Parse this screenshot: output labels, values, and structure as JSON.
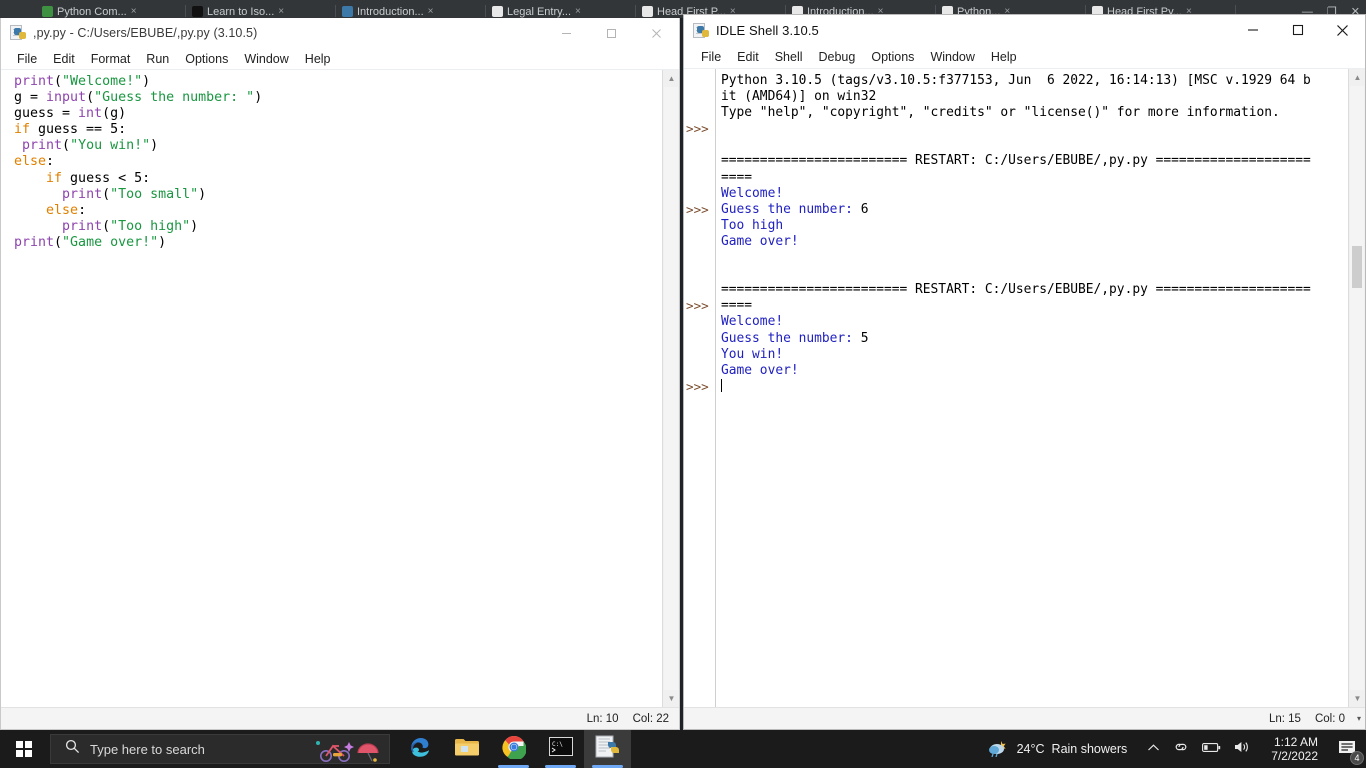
{
  "background_browser": {
    "tabs": [
      {
        "label": "Python Com...",
        "favicon_color": "#3f9142",
        "close_label": "×"
      },
      {
        "label": "Learn to Iso...",
        "favicon_color": "#111111",
        "close_label": "×"
      },
      {
        "label": "Introduction...",
        "favicon_color": "#3c78a8",
        "close_label": "×"
      },
      {
        "label": "Legal Entry...",
        "favicon_color": "#e8e8e8",
        "close_label": "×"
      },
      {
        "label": "Head First P...",
        "favicon_color": "#e8e8e8",
        "close_label": "×"
      },
      {
        "label": "Introduction...",
        "favicon_color": "#e8e8e8",
        "close_label": "×"
      },
      {
        "label": "Python...",
        "favicon_color": "#e8e8e8",
        "close_label": "×"
      },
      {
        "label": "Head First Py...",
        "favicon_color": "#e8e8e8",
        "close_label": "×"
      }
    ],
    "window_controls": {
      "minimize": "—",
      "maximize": "❐",
      "close": "✕"
    }
  },
  "editor_window": {
    "title": ",py.py - C:/Users/EBUBE/,py.py (3.10.5)",
    "icon": "python-file-icon",
    "menus": [
      "File",
      "Edit",
      "Format",
      "Run",
      "Options",
      "Window",
      "Help"
    ],
    "window_controls": {
      "minimize": "—",
      "maximize": "☐",
      "close": "✕"
    },
    "status": {
      "line_label": "Ln: 10",
      "col_label": "Col: 22"
    },
    "code_lines": [
      [
        {
          "t": "print",
          "c": "builtin"
        },
        {
          "t": "(",
          "c": "def"
        },
        {
          "t": "\"Welcome!\"",
          "c": "str"
        },
        {
          "t": ")",
          "c": "def"
        }
      ],
      [
        {
          "t": "g = ",
          "c": "def"
        },
        {
          "t": "input",
          "c": "builtin"
        },
        {
          "t": "(",
          "c": "def"
        },
        {
          "t": "\"Guess the number: \"",
          "c": "str"
        },
        {
          "t": ")",
          "c": "def"
        }
      ],
      [
        {
          "t": "guess = ",
          "c": "def"
        },
        {
          "t": "int",
          "c": "builtin"
        },
        {
          "t": "(g)",
          "c": "def"
        }
      ],
      [
        {
          "t": "if",
          "c": "kw"
        },
        {
          "t": " guess == 5:",
          "c": "def"
        }
      ],
      [
        {
          "t": " ",
          "c": "def"
        },
        {
          "t": "print",
          "c": "builtin"
        },
        {
          "t": "(",
          "c": "def"
        },
        {
          "t": "\"You win!\"",
          "c": "str"
        },
        {
          "t": ")",
          "c": "def"
        }
      ],
      [
        {
          "t": "else",
          "c": "kw"
        },
        {
          "t": ":",
          "c": "def"
        }
      ],
      [
        {
          "t": "    ",
          "c": "def"
        },
        {
          "t": "if",
          "c": "kw"
        },
        {
          "t": " guess < 5:",
          "c": "def"
        }
      ],
      [
        {
          "t": "      ",
          "c": "def"
        },
        {
          "t": "print",
          "c": "builtin"
        },
        {
          "t": "(",
          "c": "def"
        },
        {
          "t": "\"Too small\"",
          "c": "str"
        },
        {
          "t": ")",
          "c": "def"
        }
      ],
      [
        {
          "t": "    ",
          "c": "def"
        },
        {
          "t": "else",
          "c": "kw"
        },
        {
          "t": ":",
          "c": "def"
        }
      ],
      [
        {
          "t": "      ",
          "c": "def"
        },
        {
          "t": "print",
          "c": "builtin"
        },
        {
          "t": "(",
          "c": "def"
        },
        {
          "t": "\"Too high\"",
          "c": "str"
        },
        {
          "t": ")",
          "c": "def"
        }
      ],
      [
        {
          "t": "print",
          "c": "builtin"
        },
        {
          "t": "(",
          "c": "def"
        },
        {
          "t": "\"Game over!\"",
          "c": "str"
        },
        {
          "t": ")",
          "c": "def"
        }
      ]
    ]
  },
  "shell_window": {
    "title": "IDLE Shell 3.10.5",
    "icon": "python-file-icon",
    "menus": [
      "File",
      "Edit",
      "Shell",
      "Debug",
      "Options",
      "Window",
      "Help"
    ],
    "window_controls": {
      "minimize": "—",
      "maximize": "☐",
      "close": "✕"
    },
    "status": {
      "line_label": "Ln: 15",
      "col_label": "Col: 0"
    },
    "prompt_symbol": ">>>",
    "prompt_rows": [
      3,
      8,
      14
    ],
    "lines": [
      {
        "text": "Python 3.10.5 (tags/v3.10.5:f377153, Jun  6 2022, 16:14:13) [MSC v.1929 64 b",
        "style": "plain"
      },
      {
        "text": "it (AMD64)] on win32",
        "style": "plain"
      },
      {
        "text": "Type \"help\", \"copyright\", \"credits\" or \"license()\" for more information.",
        "style": "plain"
      },
      {
        "text": "",
        "style": "plain"
      },
      {
        "text": "",
        "style": "plain"
      },
      {
        "text": "======================== RESTART: C:/Users/EBUBE/,py.py ====================",
        "style": "restart"
      },
      {
        "text": "====",
        "style": "restart"
      },
      {
        "text": "Welcome!",
        "style": "out"
      },
      {
        "text": "Guess the number: 6",
        "style": "out-input",
        "input_tail": "6"
      },
      {
        "text": "Too high",
        "style": "out"
      },
      {
        "text": "Game over!",
        "style": "out"
      },
      {
        "text": "",
        "style": "plain"
      },
      {
        "text": "",
        "style": "plain"
      },
      {
        "text": "======================== RESTART: C:/Users/EBUBE/,py.py ====================",
        "style": "restart"
      },
      {
        "text": "====",
        "style": "restart"
      },
      {
        "text": "Welcome!",
        "style": "out"
      },
      {
        "text": "Guess the number: 5",
        "style": "out-input",
        "input_tail": "5"
      },
      {
        "text": "You win!",
        "style": "out"
      },
      {
        "text": "Game over!",
        "style": "out"
      },
      {
        "text": "",
        "style": "caret"
      }
    ]
  },
  "taskbar": {
    "start_label": "Start",
    "search": {
      "placeholder": "Type here to search",
      "icon": "search-icon"
    },
    "apps": [
      {
        "name": "microsoft-edge",
        "label": "Microsoft Edge",
        "running": false
      },
      {
        "name": "file-explorer",
        "label": "File Explorer",
        "running": false
      },
      {
        "name": "google-chrome",
        "label": "Google Chrome",
        "running": true
      },
      {
        "name": "command-prompt",
        "label": "Command Prompt",
        "running": true
      },
      {
        "name": "python-idle",
        "label": "IDLE",
        "running": true,
        "active": true
      }
    ],
    "weather": {
      "temperature": "24°C",
      "condition": "Rain showers",
      "icon": "rain-showers-icon"
    },
    "tray_icons": [
      "chevron-up-icon",
      "onedrive-link-icon",
      "battery-icon",
      "volume-icon"
    ],
    "clock": {
      "time": "1:12 AM",
      "date": "7/2/2022"
    },
    "notifications": {
      "count": "4",
      "icon": "action-center-icon"
    }
  },
  "colors": {
    "accent_blue": "#6fa8f5",
    "taskbar": "#1b1b1b",
    "code_string": "#1a9641",
    "code_builtin": "#8e44ad",
    "code_keyword": "#e08000",
    "shell_output": "#2020c0",
    "prompt": "#7a4a2a"
  }
}
